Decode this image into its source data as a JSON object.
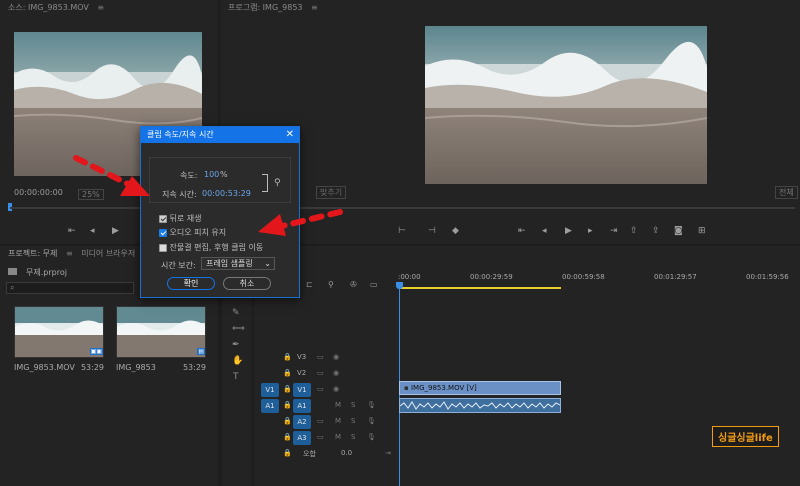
{
  "source_panel": {
    "title": "소스: IMG_9853.MOV",
    "timecode": "00:00:00:00",
    "zoom": "25%"
  },
  "program_panel": {
    "title": "프로그램: IMG_9853",
    "fit_right": "전체",
    "fit_left": "맞추기"
  },
  "dialog": {
    "title": "클립 속도/지속 시간",
    "speed_label": "속도:",
    "speed_value": "100",
    "speed_unit": "%",
    "duration_label": "지속 시간:",
    "duration_value": "00:00:53:29",
    "checkbox_reverse": "뒤로 재생",
    "reverse_checked": false,
    "checkbox_pitch": "오디오 피치 유지",
    "pitch_checked": true,
    "checkbox_ripple": "잔물결 편집, 후행 클립 이동",
    "ripple_checked": false,
    "interp_label": "시간 보간:",
    "interp_value": "프레임 샘플링",
    "ok_label": "확인",
    "cancel_label": "취소"
  },
  "project_panel": {
    "tab_project": "프로젝트: 무제",
    "tab_media": "미디어 브라우저",
    "file": "무제.prproj",
    "items": [
      {
        "name": "IMG_9853.MOV",
        "duration": "53:29"
      },
      {
        "name": "IMG_9853",
        "duration": "53:29"
      }
    ]
  },
  "timeline": {
    "timecode": "00",
    "ruler": [
      ":00:00",
      "00:00:29:59",
      "00:00:59:58",
      "00:01:29:57",
      "00:01:59:56"
    ],
    "tracks": {
      "video": [
        "V3",
        "V2",
        "V1"
      ],
      "audio": [
        "A1",
        "A2",
        "A3"
      ],
      "source_v": "V1",
      "source_a": "A1",
      "master": "오합",
      "master_value": "0.0"
    },
    "video_clip": "IMG_9853.MOV [V]"
  },
  "watermark": "싱글싱글life",
  "colors": {
    "accent": "#1473e6",
    "arrow": "#e3171b",
    "timecode_blue": "#7fb1e0",
    "watermark": "#f39c12"
  }
}
